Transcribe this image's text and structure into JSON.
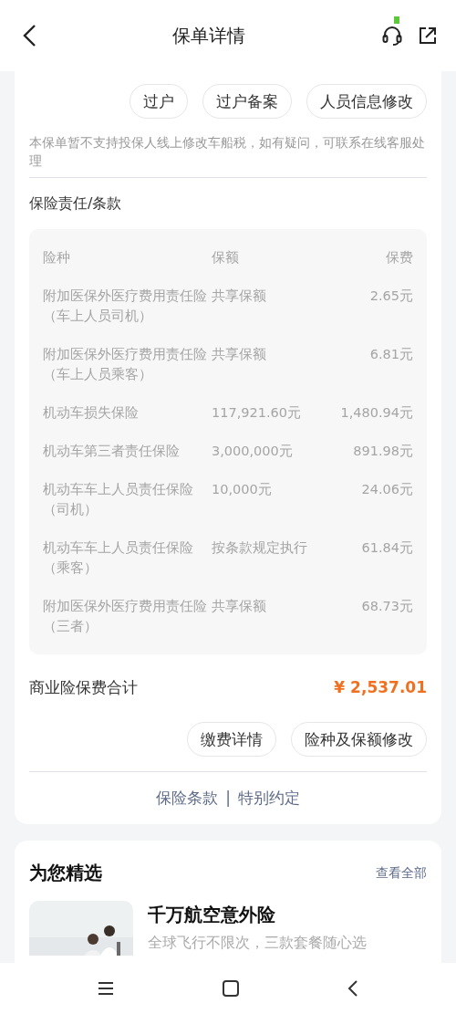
{
  "header": {
    "title": "保单详情"
  },
  "actions": [
    "过户",
    "过户备案",
    "人员信息修改"
  ],
  "notice": "本保单暂不支持投保人线上修改车船税，如有疑问，可联系在线客服处理",
  "coverage": {
    "title": "保险责任/条款",
    "columns": [
      "险种",
      "保额",
      "保费"
    ],
    "rows": [
      {
        "name": "附加医保外医疗费用责任险（车上人员司机）",
        "amount": "共享保额",
        "premium": "2.65元"
      },
      {
        "name": "附加医保外医疗费用责任险（车上人员乘客）",
        "amount": "共享保额",
        "premium": "6.81元"
      },
      {
        "name": "机动车损失保险",
        "amount": "117,921.60元",
        "premium": "1,480.94元"
      },
      {
        "name": "机动车第三者责任保险",
        "amount": "3,000,000元",
        "premium": "891.98元"
      },
      {
        "name": "机动车车上人员责任保险（司机）",
        "amount": "10,000元",
        "premium": "24.06元"
      },
      {
        "name": "机动车车上人员责任保险（乘客）",
        "amount": "按条款规定执行",
        "premium": "61.84元"
      },
      {
        "name": "附加医保外医疗费用责任险（三者）",
        "amount": "共享保额",
        "premium": "68.73元"
      }
    ]
  },
  "total": {
    "label": "商业险保费合计",
    "value": "¥ 2,537.01"
  },
  "total_actions": [
    "缴费详情",
    "险种及保额修改"
  ],
  "links": [
    "保险条款",
    "|",
    "特别约定"
  ],
  "recommend": {
    "title": "为您精选",
    "view_all": "查看全部",
    "product": {
      "title": "千万航空意外险",
      "subtitle": "全球飞行不限次，三款套餐随心选"
    }
  }
}
